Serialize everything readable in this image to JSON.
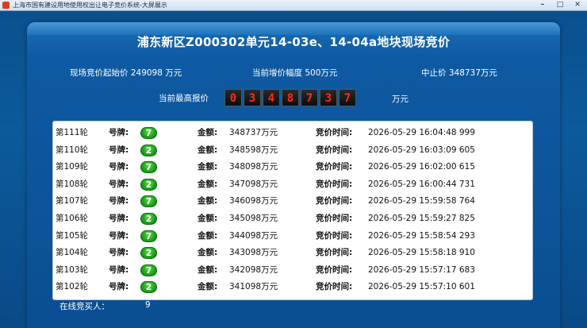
{
  "window": {
    "title": "上海市国有建设用地使用权出让电子竞价系统-大屏展示",
    "minimize": "–",
    "maximize": "□",
    "close": "✕"
  },
  "heading": "浦东新区Z000302单元14-03e、14-04a地块现场竞价",
  "info": {
    "start_price": "现场竞价起始价 249098 万元",
    "increment": "当前增价幅度 500万元",
    "cap_price": "中止价 348737万元"
  },
  "highest_price": {
    "label": "当前最高报价",
    "digits": [
      "0",
      "3",
      "4",
      "8",
      "7",
      "3",
      "7"
    ],
    "unit": "万元"
  },
  "labels": {
    "plate": "号牌:",
    "amount": "金额:",
    "time": "竞价时间:"
  },
  "bids": [
    {
      "round": "第111轮",
      "plate": "7",
      "amount": "348737万元",
      "time": "2026-05-29 16:04:48 999"
    },
    {
      "round": "第110轮",
      "plate": "2",
      "amount": "348598万元",
      "time": "2026-05-29 16:03:09 605"
    },
    {
      "round": "第109轮",
      "plate": "7",
      "amount": "348098万元",
      "time": "2026-05-29 16:02:00 615"
    },
    {
      "round": "第108轮",
      "plate": "2",
      "amount": "347098万元",
      "time": "2026-05-29 16:00:44 731"
    },
    {
      "round": "第107轮",
      "plate": "7",
      "amount": "346098万元",
      "time": "2026-05-29 15:59:58 764"
    },
    {
      "round": "第106轮",
      "plate": "2",
      "amount": "345098万元",
      "time": "2026-05-29 15:59:27 825"
    },
    {
      "round": "第105轮",
      "plate": "7",
      "amount": "344098万元",
      "time": "2026-05-29 15:58:54 293"
    },
    {
      "round": "第104轮",
      "plate": "2",
      "amount": "343098万元",
      "time": "2026-05-29 15:58:18 910"
    },
    {
      "round": "第103轮",
      "plate": "7",
      "amount": "342098万元",
      "time": "2026-05-29 15:57:17 683"
    },
    {
      "round": "第102轮",
      "plate": "2",
      "amount": "341098万元",
      "time": "2026-05-29 15:57:10 601"
    }
  ],
  "online": {
    "label": "在线竞买人：",
    "count": "9"
  }
}
